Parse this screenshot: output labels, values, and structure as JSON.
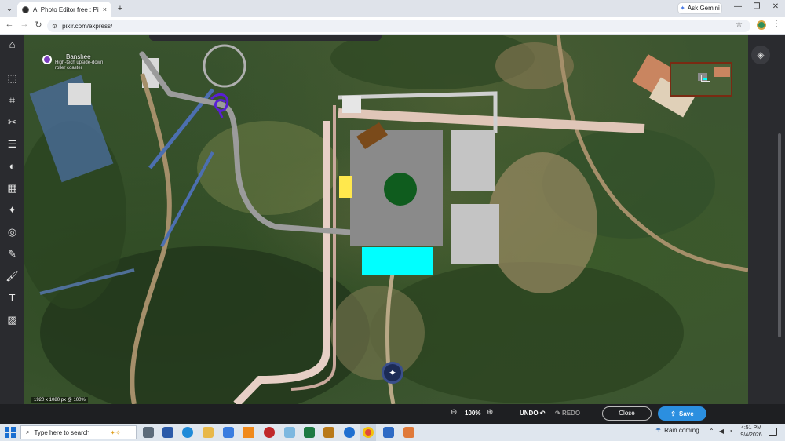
{
  "browser": {
    "tab_title": "AI Photo Editor free : Pixlr Express",
    "tab_close": "×",
    "new_tab": "+",
    "ask_gemini": "Ask Gemini",
    "url": "pixlr.com/express/",
    "window_controls": {
      "minimize": "—",
      "restore": "❐",
      "close": "✕"
    }
  },
  "map_labels": {
    "banshee_name": "Banshee",
    "banshee_desc": "High-tech upside-down roller coaster"
  },
  "canvas": {
    "size_info": "1920 x 1080 px @ 100%"
  },
  "bottom_bar": {
    "zoom_out": "⊖",
    "zoom_level": "100%",
    "zoom_in": "⊕",
    "undo_label": "UNDO",
    "redo_label": "REDO",
    "close_label": "Close",
    "save_label": "Save"
  },
  "taskbar": {
    "search_placeholder": "Type here to search",
    "weather": "Rain coming",
    "time": "4:51 PM",
    "date": "9/4/2026"
  },
  "shape_colors": {
    "gray_block": "#8a8a8a",
    "light_gray_block": "#c4c4c4",
    "cyan_block": "#00ffff",
    "yellow_block": "#ffe84d",
    "brown_block": "#7a4a1a",
    "green_circle": "#0f5c1e",
    "path_gray": "#9b9b9b",
    "purple_scribble": "#5a1fd6",
    "save_blue": "#2b8fe0"
  }
}
